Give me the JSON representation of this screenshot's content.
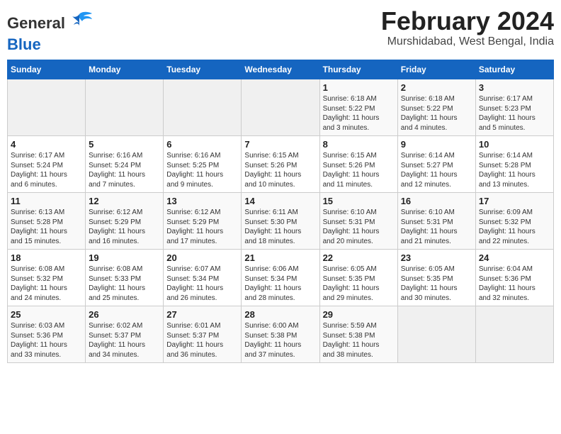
{
  "header": {
    "title": "February 2024",
    "subtitle": "Murshidabad, West Bengal, India"
  },
  "logo": {
    "line1": "General",
    "line2": "Blue"
  },
  "weekdays": [
    "Sunday",
    "Monday",
    "Tuesday",
    "Wednesday",
    "Thursday",
    "Friday",
    "Saturday"
  ],
  "weeks": [
    [
      {
        "day": "",
        "detail": ""
      },
      {
        "day": "",
        "detail": ""
      },
      {
        "day": "",
        "detail": ""
      },
      {
        "day": "",
        "detail": ""
      },
      {
        "day": "1",
        "detail": "Sunrise: 6:18 AM\nSunset: 5:22 PM\nDaylight: 11 hours\nand 3 minutes."
      },
      {
        "day": "2",
        "detail": "Sunrise: 6:18 AM\nSunset: 5:22 PM\nDaylight: 11 hours\nand 4 minutes."
      },
      {
        "day": "3",
        "detail": "Sunrise: 6:17 AM\nSunset: 5:23 PM\nDaylight: 11 hours\nand 5 minutes."
      }
    ],
    [
      {
        "day": "4",
        "detail": "Sunrise: 6:17 AM\nSunset: 5:24 PM\nDaylight: 11 hours\nand 6 minutes."
      },
      {
        "day": "5",
        "detail": "Sunrise: 6:16 AM\nSunset: 5:24 PM\nDaylight: 11 hours\nand 7 minutes."
      },
      {
        "day": "6",
        "detail": "Sunrise: 6:16 AM\nSunset: 5:25 PM\nDaylight: 11 hours\nand 9 minutes."
      },
      {
        "day": "7",
        "detail": "Sunrise: 6:15 AM\nSunset: 5:26 PM\nDaylight: 11 hours\nand 10 minutes."
      },
      {
        "day": "8",
        "detail": "Sunrise: 6:15 AM\nSunset: 5:26 PM\nDaylight: 11 hours\nand 11 minutes."
      },
      {
        "day": "9",
        "detail": "Sunrise: 6:14 AM\nSunset: 5:27 PM\nDaylight: 11 hours\nand 12 minutes."
      },
      {
        "day": "10",
        "detail": "Sunrise: 6:14 AM\nSunset: 5:28 PM\nDaylight: 11 hours\nand 13 minutes."
      }
    ],
    [
      {
        "day": "11",
        "detail": "Sunrise: 6:13 AM\nSunset: 5:28 PM\nDaylight: 11 hours\nand 15 minutes."
      },
      {
        "day": "12",
        "detail": "Sunrise: 6:12 AM\nSunset: 5:29 PM\nDaylight: 11 hours\nand 16 minutes."
      },
      {
        "day": "13",
        "detail": "Sunrise: 6:12 AM\nSunset: 5:29 PM\nDaylight: 11 hours\nand 17 minutes."
      },
      {
        "day": "14",
        "detail": "Sunrise: 6:11 AM\nSunset: 5:30 PM\nDaylight: 11 hours\nand 18 minutes."
      },
      {
        "day": "15",
        "detail": "Sunrise: 6:10 AM\nSunset: 5:31 PM\nDaylight: 11 hours\nand 20 minutes."
      },
      {
        "day": "16",
        "detail": "Sunrise: 6:10 AM\nSunset: 5:31 PM\nDaylight: 11 hours\nand 21 minutes."
      },
      {
        "day": "17",
        "detail": "Sunrise: 6:09 AM\nSunset: 5:32 PM\nDaylight: 11 hours\nand 22 minutes."
      }
    ],
    [
      {
        "day": "18",
        "detail": "Sunrise: 6:08 AM\nSunset: 5:32 PM\nDaylight: 11 hours\nand 24 minutes."
      },
      {
        "day": "19",
        "detail": "Sunrise: 6:08 AM\nSunset: 5:33 PM\nDaylight: 11 hours\nand 25 minutes."
      },
      {
        "day": "20",
        "detail": "Sunrise: 6:07 AM\nSunset: 5:34 PM\nDaylight: 11 hours\nand 26 minutes."
      },
      {
        "day": "21",
        "detail": "Sunrise: 6:06 AM\nSunset: 5:34 PM\nDaylight: 11 hours\nand 28 minutes."
      },
      {
        "day": "22",
        "detail": "Sunrise: 6:05 AM\nSunset: 5:35 PM\nDaylight: 11 hours\nand 29 minutes."
      },
      {
        "day": "23",
        "detail": "Sunrise: 6:05 AM\nSunset: 5:35 PM\nDaylight: 11 hours\nand 30 minutes."
      },
      {
        "day": "24",
        "detail": "Sunrise: 6:04 AM\nSunset: 5:36 PM\nDaylight: 11 hours\nand 32 minutes."
      }
    ],
    [
      {
        "day": "25",
        "detail": "Sunrise: 6:03 AM\nSunset: 5:36 PM\nDaylight: 11 hours\nand 33 minutes."
      },
      {
        "day": "26",
        "detail": "Sunrise: 6:02 AM\nSunset: 5:37 PM\nDaylight: 11 hours\nand 34 minutes."
      },
      {
        "day": "27",
        "detail": "Sunrise: 6:01 AM\nSunset: 5:37 PM\nDaylight: 11 hours\nand 36 minutes."
      },
      {
        "day": "28",
        "detail": "Sunrise: 6:00 AM\nSunset: 5:38 PM\nDaylight: 11 hours\nand 37 minutes."
      },
      {
        "day": "29",
        "detail": "Sunrise: 5:59 AM\nSunset: 5:38 PM\nDaylight: 11 hours\nand 38 minutes."
      },
      {
        "day": "",
        "detail": ""
      },
      {
        "day": "",
        "detail": ""
      }
    ]
  ]
}
